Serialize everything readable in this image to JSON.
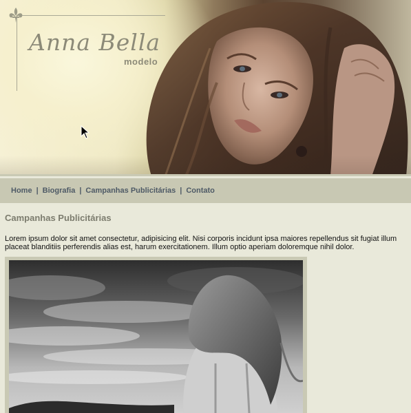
{
  "header": {
    "logo_name": "Anna Bella",
    "logo_sub": "modelo"
  },
  "nav": {
    "items": [
      {
        "label": "Home"
      },
      {
        "label": "Biografia"
      },
      {
        "label": "Campanhas Publicitárias"
      },
      {
        "label": "Contato"
      }
    ],
    "separator": "|"
  },
  "main": {
    "title": "Campanhas Publicitárias",
    "intro": "Lorem ipsum dolor sit amet consectetur, adipisicing elit. Nisi corporis incidunt ipsa maiores repellendus sit fugiat illum placeat blanditiis perferendis alias est, harum exercitationem. Illum optio aperiam doloremque nihil dolor."
  },
  "icons": {
    "logo_ornament": "fleur-de-lis-icon",
    "pointer": "mouse-cursor-icon"
  },
  "colors": {
    "page_background": "#e9e9da",
    "nav_background": "#c8c8b3",
    "nav_text": "#4e5a66",
    "title_text": "#7c7c6e",
    "logo_text": "#8c8a78"
  }
}
